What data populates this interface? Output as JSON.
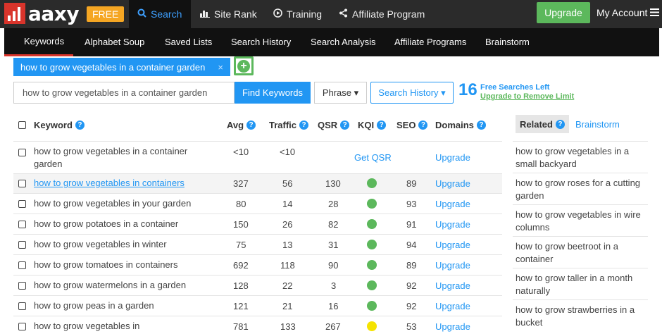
{
  "brand": {
    "logo_text": "aaxy",
    "free_badge": "FREE"
  },
  "topnav": [
    {
      "label": "Search",
      "icon": "search-icon",
      "active": true
    },
    {
      "label": "Site Rank",
      "icon": "bar-chart-icon",
      "active": false
    },
    {
      "label": "Training",
      "icon": "play-circle-icon",
      "active": false
    },
    {
      "label": "Affiliate Program",
      "icon": "share-icon",
      "active": false
    }
  ],
  "upgrade_label": "Upgrade",
  "account_label": "My Account",
  "subnav": [
    {
      "label": "Keywords",
      "active": true
    },
    {
      "label": "Alphabet Soup"
    },
    {
      "label": "Saved Lists"
    },
    {
      "label": "Search History"
    },
    {
      "label": "Search Analysis"
    },
    {
      "label": "Affiliate Programs"
    },
    {
      "label": "Brainstorm"
    }
  ],
  "tag": {
    "label": "how to grow vegetables in a container garden",
    "close": "×"
  },
  "add_label": "+",
  "search": {
    "value": "how to grow vegetables in a container garden",
    "find_label": "Find Keywords",
    "phrase_label": "Phrase ▾",
    "history_label": "Search History ▾"
  },
  "free_searches": {
    "count": "16",
    "label": "Free Searches Left",
    "link": "Upgrade to Remove Limit"
  },
  "table": {
    "headers": {
      "keyword": "Keyword",
      "avg": "Avg",
      "traffic": "Traffic",
      "qsr": "QSR",
      "kqi": "KQI",
      "seo": "SEO",
      "domains": "Domains"
    },
    "rows": [
      {
        "keyword": "how to grow vegetables in a container garden",
        "avg": "<10",
        "traffic": "<10",
        "qsr": "",
        "kqi": "Get QSR",
        "seo": "",
        "domains": "Upgrade",
        "kqi_color": ""
      },
      {
        "keyword": "how to grow vegetables in containers",
        "avg": "327",
        "traffic": "56",
        "qsr": "130",
        "kqi": "",
        "seo": "89",
        "domains": "Upgrade",
        "kqi_color": "#5cb85c"
      },
      {
        "keyword": "how to grow vegetables in your garden",
        "avg": "80",
        "traffic": "14",
        "qsr": "28",
        "kqi": "",
        "seo": "93",
        "domains": "Upgrade",
        "kqi_color": "#5cb85c"
      },
      {
        "keyword": "how to grow potatoes in a container",
        "avg": "150",
        "traffic": "26",
        "qsr": "82",
        "kqi": "",
        "seo": "91",
        "domains": "Upgrade",
        "kqi_color": "#5cb85c"
      },
      {
        "keyword": "how to grow vegetables in winter",
        "avg": "75",
        "traffic": "13",
        "qsr": "31",
        "kqi": "",
        "seo": "94",
        "domains": "Upgrade",
        "kqi_color": "#5cb85c"
      },
      {
        "keyword": "how to grow tomatoes in containers",
        "avg": "692",
        "traffic": "118",
        "qsr": "90",
        "kqi": "",
        "seo": "89",
        "domains": "Upgrade",
        "kqi_color": "#5cb85c"
      },
      {
        "keyword": "how to grow watermelons in a garden",
        "avg": "128",
        "traffic": "22",
        "qsr": "3",
        "kqi": "",
        "seo": "92",
        "domains": "Upgrade",
        "kqi_color": "#5cb85c"
      },
      {
        "keyword": "how to grow peas in a garden",
        "avg": "121",
        "traffic": "21",
        "qsr": "16",
        "kqi": "",
        "seo": "92",
        "domains": "Upgrade",
        "kqi_color": "#5cb85c"
      },
      {
        "keyword": "how to grow vegetables in",
        "avg": "781",
        "traffic": "133",
        "qsr": "267",
        "kqi": "",
        "seo": "53",
        "domains": "Upgrade",
        "kqi_color": "#f5e300"
      }
    ]
  },
  "sidebar": {
    "tab_related": "Related",
    "tab_brainstorm": "Brainstorm",
    "items": [
      "how to grow vegetables in a small backyard",
      "how to grow roses for a cutting garden",
      "how to grow vegetables in wire columns",
      "how to grow beetroot in a container",
      "how to grow taller in a month naturally",
      "how to grow strawberries in a bucket"
    ]
  }
}
